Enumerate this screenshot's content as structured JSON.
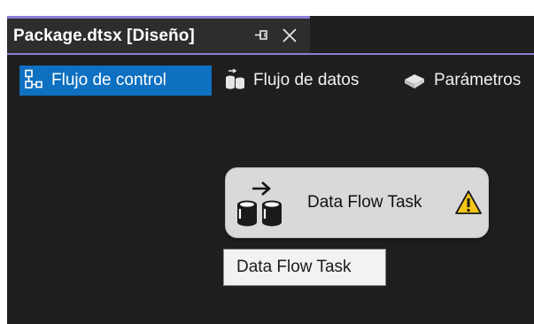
{
  "document_tab": {
    "title": "Package.dtsx [Diseño]",
    "pin_icon": "pin-icon",
    "close_icon": "close-icon"
  },
  "designer_tabs": [
    {
      "label": "Flujo de control",
      "icon": "control-flow-icon",
      "active": true
    },
    {
      "label": "Flujo de datos",
      "icon": "data-flow-icon",
      "active": false
    },
    {
      "label": "Parámetros",
      "icon": "parameters-icon",
      "active": false
    }
  ],
  "canvas": {
    "task": {
      "label": "Data Flow Task",
      "icon": "data-flow-task-icon",
      "status_icon": "warning-icon"
    },
    "tooltip": {
      "text": "Data Flow Task"
    }
  },
  "colors": {
    "accent": "#8f7bd6",
    "active_tab": "#0e70c0",
    "background": "#1e1e1e",
    "warning": "#f5c518"
  }
}
